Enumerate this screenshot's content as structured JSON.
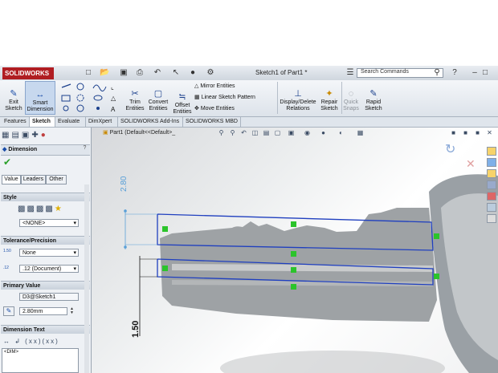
{
  "app": {
    "logo": "SOLIDWORKS",
    "window_title": "Sketch1 of Part1 *"
  },
  "search": {
    "placeholder": "Search Commands"
  },
  "quick_access": [
    "new-icon",
    "open-icon",
    "save-icon",
    "print-icon",
    "undo-icon",
    "select-icon",
    "rebuild-icon",
    "options-icon"
  ],
  "ribbon": {
    "exit_sketch": "Exit\nSketch",
    "smart_dimension": "Smart\nDimension",
    "trim_entities": "Trim\nEntities",
    "convert_entities": "Convert\nEntities",
    "offset_entities": "Offset\nEntities",
    "mirror_entities": "Mirror Entities",
    "linear_pattern": "Linear Sketch Pattern",
    "move_entities": "Move Entities",
    "display_delete": "Display/Delete\nRelations",
    "repair_sketch": "Repair\nSketch",
    "quick_snaps": "Quick\nSnaps",
    "rapid_sketch": "Rapid\nSketch"
  },
  "tabs": [
    "Features",
    "Sketch",
    "Evaluate",
    "DimXpert",
    "SOLIDWORKS Add-Ins",
    "SOLIDWORKS MBD"
  ],
  "active_tab": "Sketch",
  "tree": {
    "part_label": "Part1  (Default<<Default>_"
  },
  "property_manager": {
    "title": "Dimension",
    "help": "?",
    "subtabs": [
      "Value",
      "Leaders",
      "Other"
    ],
    "style_header": "Style",
    "style_select": "<NONE>",
    "tolerance_header": "Tolerance/Precision",
    "tolerance_type": "None",
    "precision": ".12 (Document)",
    "tol_icon_label": "1.50",
    "prec_icon_label": ".12",
    "primary_header": "Primary Value",
    "primary_name": "D3@Sketch1",
    "primary_value": "2.80mm",
    "dimtext_header": "Dimension Text",
    "dimtext_value": "<DIM>"
  },
  "dimensions": {
    "top": "2.80",
    "left": "1.50"
  },
  "colors": {
    "accent": "#1f3fbf",
    "brand": "#b01d22",
    "dimension": "#5aa0d8",
    "relation": "#2bc42b"
  }
}
